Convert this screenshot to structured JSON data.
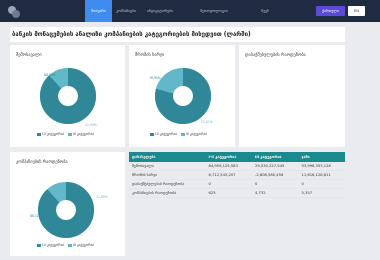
{
  "nav": {
    "items": [
      "მთავარი",
      "კომპანიები",
      "ინდიკატორები",
      "მეთოდოლოგია",
      "ჩვენ"
    ],
    "lang_primary": "ქართული",
    "lang_secondary": "EN"
  },
  "page_title": "ბანკის მონაცემების ანალიზი კომპანიების კატეგორიების მიხედვით (ლარში)",
  "colors": {
    "primary": "#2f8797",
    "secondary": "#62b7c9",
    "topbar": "#1f2b41",
    "table_header": "#1a8a8f"
  },
  "legend": {
    "series1": "I-ll კატეგორია",
    "series2": "III კატეგორია"
  },
  "charts": [
    {
      "title": "შემოსავალი",
      "s1_label": "88,06%",
      "s2_label": "11,94%"
    },
    {
      "title": "შრომის ხარჯი",
      "s1_label": "78,99%",
      "s2_label": "21,01%"
    },
    {
      "title": "დასაქმებულების რაოდენობა"
    },
    {
      "title": "კომპანიების რაოდენობა",
      "s1_label": "88,11%",
      "s2_label": "11,89%"
    }
  ],
  "chart_data": [
    {
      "type": "pie",
      "title": "შემოსავალი",
      "categories": [
        "I-ll კატეგორია",
        "III კატეგორია"
      ],
      "values": [
        88.06,
        11.94
      ]
    },
    {
      "type": "pie",
      "title": "შრომის ხარჯი",
      "categories": [
        "I-ll კატეგორია",
        "III კატეგორია"
      ],
      "values": [
        78.99,
        21.01
      ]
    },
    {
      "type": "pie",
      "title": "კომპანიების რაოდენობა",
      "categories": [
        "I-ll კატეგორია",
        "III კატეგორია"
      ],
      "values": [
        88.11,
        11.89
      ]
    }
  ],
  "table": {
    "headers": [
      "დასახელება",
      "I-ll კატეგორია",
      "III კატეგორია",
      "ჯამი"
    ],
    "rows": [
      [
        "შემოსავალი",
        "64,959,125,583",
        "29,030,227,545",
        "93,996,353,128"
      ],
      [
        "შრომის ხარჯი",
        "6,712,543,207",
        "-2,808,580,456",
        "11,616,128,611"
      ],
      [
        "დასაქმებულების რაოდენობა",
        "0",
        "0",
        "0"
      ],
      [
        "კომპანიების რაოდენობა",
        "625",
        "4,732",
        "5,357"
      ]
    ]
  }
}
